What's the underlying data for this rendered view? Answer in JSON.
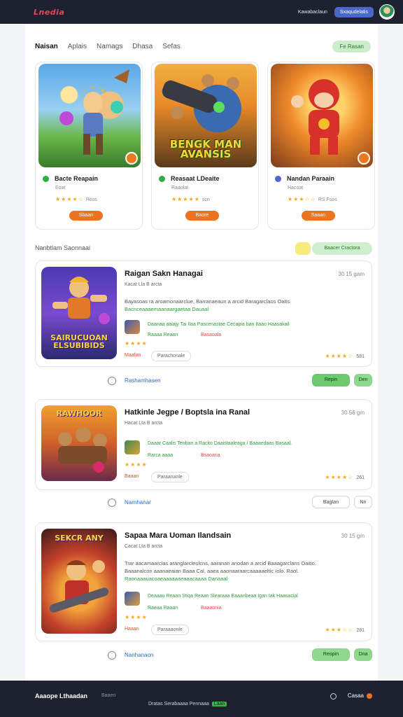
{
  "header": {
    "logo": "Lnedia",
    "link": "Kawabaclaun",
    "button": "Sxaqudelatis"
  },
  "nav": {
    "tabs": [
      "Naisan",
      "Aplais",
      "Namags",
      "Dhasa",
      "Sefas"
    ],
    "cta": "Fe Rasan"
  },
  "featured": [
    {
      "title": "Bacte Reapain",
      "sub": "Eoat",
      "stars": "★★★★☆",
      "meta": "Rcos",
      "button": "Sbaan",
      "art_text": "",
      "dot_color": "#2fae43"
    },
    {
      "title": "Reasaat LDeaite",
      "sub": "Raaolat",
      "stars": "★★★★★",
      "meta": "scn",
      "button": "Baore",
      "art_text": "BENGK MAN AVANSIS",
      "dot_color": "#2fae43"
    },
    {
      "title": "Nandan Paraain",
      "sub": "Hacoat",
      "stars": "★★★☆☆",
      "meta": "RS Fsos",
      "button": "Saaan",
      "art_text": "",
      "dot_color": "#4a68c9"
    }
  ],
  "section": {
    "title": "Nanbtlam Saonnaai",
    "pill": "Baacer Cractora"
  },
  "games": [
    {
      "title": "Raigan Sakn Hanagai",
      "time": "30 15 gam",
      "sub": "Kacat Lla B arcta",
      "desc_plain": "Bayasoas ra aroamonaarclue, Barranaeaun a arcid Baragarclaos Oaits.",
      "desc_link": "Bacnceaaaemaanaargaetaa Dauaal",
      "mini_text": "Daanaa aaiajy Tai Ilaa Pascenastae Cecapia ban Itaao Haasakail",
      "mini_sub": "Raaaa Reaan",
      "mini_red": "Basaoala",
      "stars": "★★★★",
      "tag": "Maafan",
      "chip": "Parachonale",
      "rating_stars": "★★★★☆",
      "rating_num": "581",
      "thumb_text": "SAIRUCUOAN ELSUBIBIDS",
      "link": "Rashamhasen",
      "btn1": "Repin",
      "btn2": "Den"
    },
    {
      "title": "Hatkinle Jegpe / Boptsla ina Ranal",
      "time": "30 56 gm",
      "sub": "Hacat Lta B arcta",
      "desc_plain": "",
      "desc_link": "",
      "mini_text": "Daaar Caalis Tenban a Racko Daaistaaleaga / Baaaedaas Basaal.",
      "mini_sub": "Rarca aaaa",
      "mini_red": "Bsaoaria",
      "stars": "★★★★",
      "tag": "Baaan",
      "chip": "Paraananle",
      "rating_stars": "★★★★☆",
      "rating_num": "261",
      "thumb_text": "RAWHOOR",
      "link": "Narnhanar",
      "btn1": "Bagtan",
      "btn2": "Nn"
    },
    {
      "title": "Sapaa Mara Uoman Ilandsain",
      "time": "30 15 gm",
      "sub": "Cacat Lta B arcta",
      "desc_plain": "Trar aacamaarclas aranglarcleolcns, aaranan anodan a arcid Baaagarclans Oaitio. Baaanalcon aaanaeaian Baaa Cal, aaea aaonaaraarcaaaaaeltic Iolo. Raol.",
      "desc_link": "Raonaaauacoaeaaaaaaeaaacaaaa Danaaal",
      "mini_text": "Deaaau Reaan Stiqa Reaan Slearaaa Eaaanbeaa Igan Iak Haasacial",
      "mini_sub": "Raeaa Raaan",
      "mini_red": "Baaaonia",
      "stars": "★★★★",
      "tag": "Haaan",
      "chip": "Paraaaonle",
      "rating_stars": "★★★☆☆",
      "rating_num": "281",
      "thumb_text": "SEKCR ANY",
      "link": "Nanhanaon",
      "btn1": "Reopin",
      "btn2": "Dna"
    }
  ],
  "footer": {
    "brand": "Aaaope Lthaadan",
    "link": "Baaen",
    "line": "Dratas Serabaaaa Pennaaa",
    "badge": "Laan",
    "right": "Casaa"
  }
}
